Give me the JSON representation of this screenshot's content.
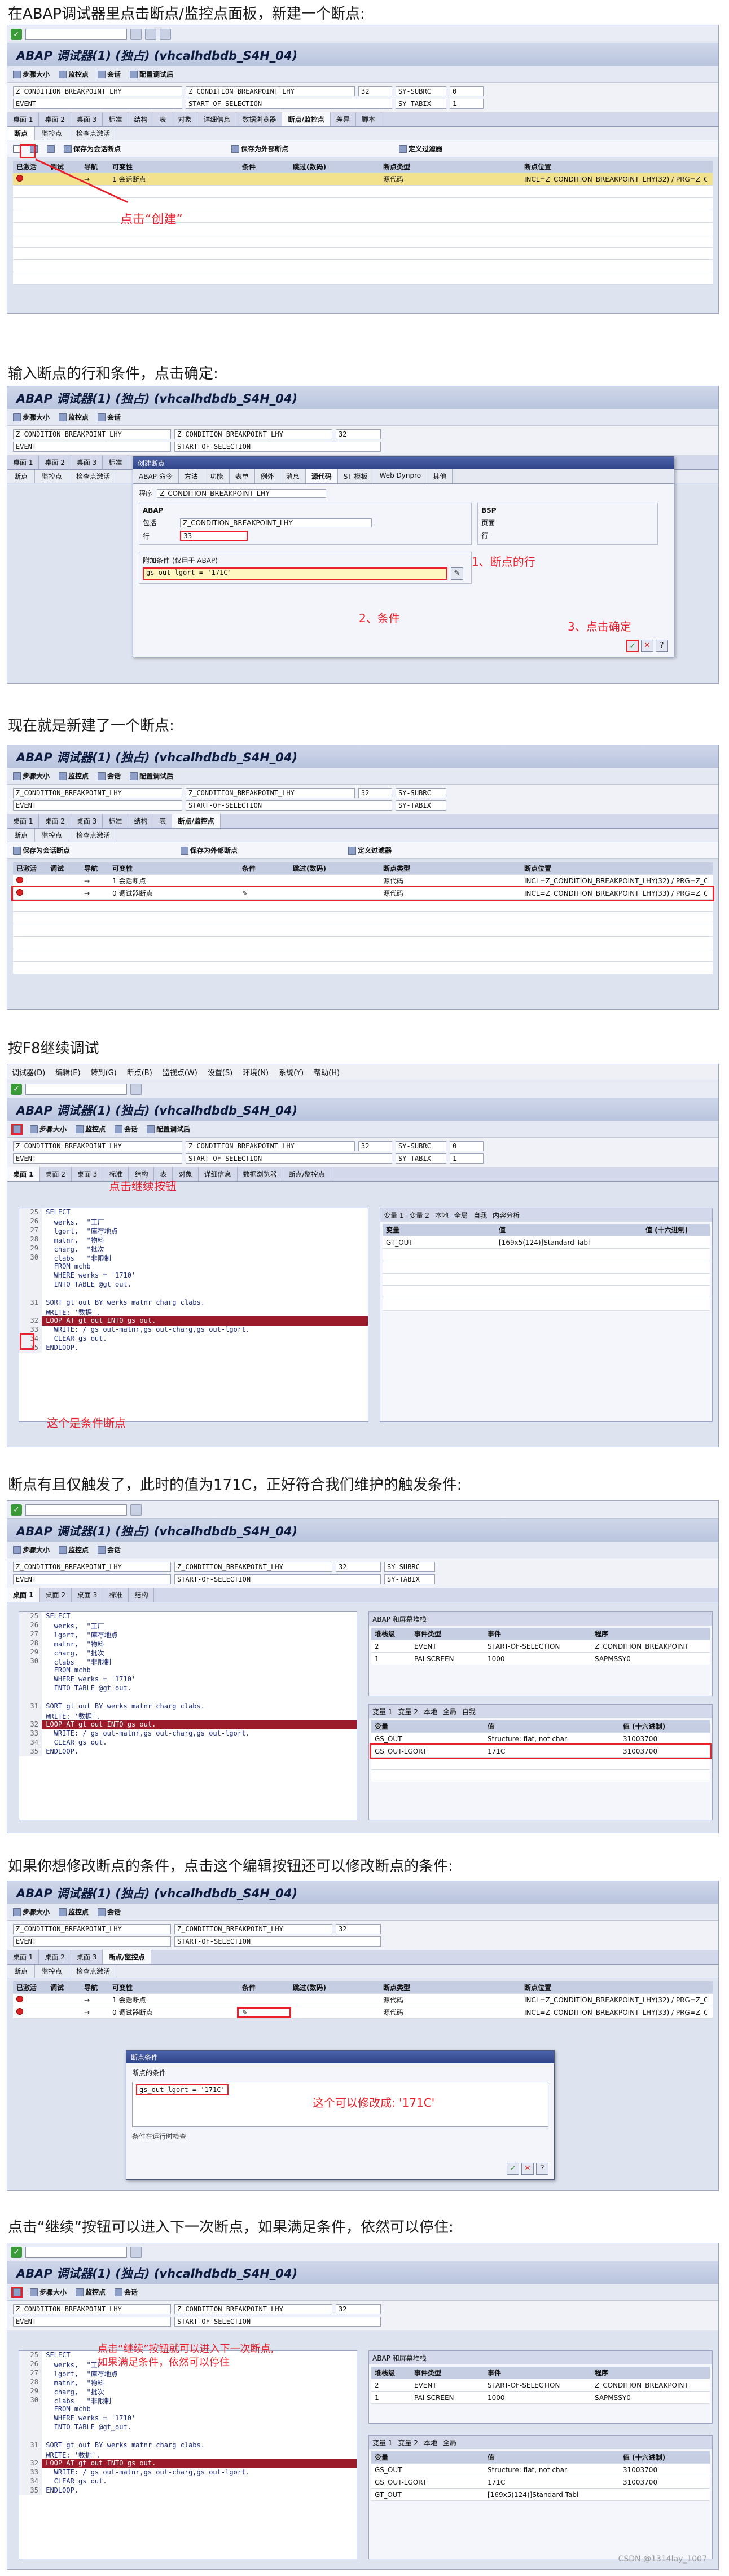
{
  "steps": [
    "在ABAP调试器里点击断点/监控点面板，新建一个断点:",
    "输入断点的行和条件，点击确定:",
    "现在就是新建了一个断点:",
    "按F8继续调试",
    "断点有且仅触发了，此时的值为171C，正好符合我们维护的触发条件:",
    "如果你想修改断点的条件，点击这个编辑按钮还可以修改断点的条件:",
    "点击“继续”按钮可以进入下一次断点，如果满足条件，依然可以停住:"
  ],
  "app_title": "ABAP 调试器(1) (独占) (vhcalhdbdb_S4H_04)",
  "menu": [
    "调试器(D)",
    "编辑(E)",
    "转到(G)",
    "断点(B)",
    "监视点(W)",
    "设置(S)",
    "环境(N)",
    "系统(Y)",
    "帮助(H)"
  ],
  "toolbar2": [
    "步骤大小",
    "监控点",
    "会话",
    "配置调试后"
  ],
  "fields": {
    "prog1": "Z_CONDITION_BREAKPOINT_LHY",
    "prog2": "Z_CONDITION_BREAKPOINT_LHY",
    "line": "32",
    "sy_subrc_label": "SY-SUBRC",
    "sy_subrc": "0",
    "event_label": "EVENT",
    "event": "START-OF-SELECTION",
    "sy_tabix_label": "SY-TABIX",
    "sy_tabix": "1"
  },
  "tabs": [
    "桌面 1",
    "桌面 2",
    "桌面 3",
    "标准",
    "结构",
    "表",
    "对象",
    "详细信息",
    "数据浏览器",
    "断点/监控点",
    "差异",
    "脚本"
  ],
  "subtabs": [
    "断点",
    "监控点",
    "检查点激活"
  ],
  "bp_toolbar": [
    "保存为会话断点",
    "保存为外部断点",
    "定义过滤器"
  ],
  "bp_table": {
    "headers": [
      "已激活",
      "调试",
      "导航",
      "可变性",
      "条件",
      "跳过(数码)",
      "断点类型",
      "断点位置"
    ],
    "rows1": [
      {
        "num": "1",
        "type": "会话断点",
        "loc_type": "源代码",
        "loc": "INCL=Z_CONDITION_BREAKPOINT_LHY(32) / PRG=Z_C"
      }
    ],
    "rows2": [
      {
        "num": "1",
        "type": "会话断点",
        "loc_type": "源代码",
        "loc": "INCL=Z_CONDITION_BREAKPOINT_LHY(32) / PRG=Z_C"
      },
      {
        "num": "0",
        "type": "调试器断点",
        "loc_type": "源代码",
        "loc": "INCL=Z_CONDITION_BREAKPOINT_LHY(33) / PRG=Z_C"
      }
    ]
  },
  "annotations": {
    "create": "点击“创建”",
    "line": "1、断点的行",
    "cond": "2、条件",
    "ok": "3、点击确定",
    "next": "点击继续按钮",
    "cond_bp": "这个是条件断点",
    "modify": "这个可以修改成: '171C'",
    "continue": "点击“继续”按钮就可以进入下一次断点,\n如果满足条件，依然可以停住"
  },
  "dialog1": {
    "title": "创建断点",
    "tabs": [
      "ABAP 命令",
      "方法",
      "功能",
      "表单",
      "例外",
      "消息",
      "源代码",
      "ST 模板",
      "Web Dynpro",
      "其他"
    ],
    "prog_label": "程序",
    "prog": "Z_CONDITION_BREAKPOINT_LHY",
    "incl_label": "包括",
    "incl": "Z_CONDITION_BREAKPOINT_LHY",
    "line_label": "行",
    "line": "33",
    "cond_label": "附加条件 (仅用于 ABAP)",
    "cond": "gs_out-lgort = '171C'",
    "sec_abap": "ABAP",
    "sec_bsp": "BSP",
    "page_label": "页面",
    "bsp_line": "行"
  },
  "dialog2": {
    "title": "断点条件",
    "label": "断点的条件",
    "cond": "gs_out-lgort = '171C'",
    "status": "条件在运行时检查"
  },
  "code": [
    {
      "n": "25",
      "t": "SELECT"
    },
    {
      "n": "26",
      "t": "  werks,  \"工厂"
    },
    {
      "n": "27",
      "t": "  lgort,  \"库存地点"
    },
    {
      "n": "28",
      "t": "  matnr,  \"物料"
    },
    {
      "n": "29",
      "t": "  charg,  \"批次"
    },
    {
      "n": "30",
      "t": "  clabs   \"非限制"
    },
    {
      "n": "",
      "t": "  FROM mchb"
    },
    {
      "n": "",
      "t": "  WHERE werks = '1710'"
    },
    {
      "n": "",
      "t": "  INTO TABLE @gt_out."
    },
    {
      "n": "",
      "t": ""
    },
    {
      "n": "31",
      "t": "SORT gt_out BY werks matnr charg clabs."
    },
    {
      "n": "",
      "t": "WRITE: '数据'."
    },
    {
      "n": "32",
      "t": "LOOP AT gt_out INTO gs_out."
    },
    {
      "n": "33",
      "t": "  WRITE: / gs_out-matnr,gs_out-charg,gs_out-lgort."
    },
    {
      "n": "34",
      "t": "  CLEAR gs_out."
    },
    {
      "n": "35",
      "t": "ENDLOOP."
    }
  ],
  "var_panel": {
    "tabs": [
      "变量 1",
      "变量 2",
      "本地",
      "全局",
      "自我",
      "内容分析"
    ],
    "headers": [
      "变量",
      "值",
      "值 (十六进制)"
    ],
    "rows1": [
      {
        "var": "GT_OUT",
        "val": "[169x5(124)]Standard Tabl"
      }
    ],
    "rows2": [
      {
        "var": "GS_OUT",
        "val": "Structure: flat, not char",
        "hex": "31003700"
      },
      {
        "var": "GS_OUT-LGORT",
        "val": "171C",
        "hex": "31003700"
      }
    ],
    "rows3": [
      {
        "var": "GS_OUT",
        "val": "Structure: flat, not char",
        "hex": "31003700"
      },
      {
        "var": "GS_OUT-LGORT",
        "val": "171C",
        "hex": "31003700"
      },
      {
        "var": "GT_OUT",
        "val": "[169x5(124)]Standard Tabl",
        "hex": ""
      }
    ]
  },
  "stack_panel": {
    "title": "ABAP 和屏幕堆栈",
    "headers": [
      "堆栈级",
      "事件类型",
      "事件",
      "程序"
    ],
    "rows": [
      {
        "lvl": "2",
        "type": "EVENT",
        "ev": "START-OF-SELECTION",
        "prog": "Z_CONDITION_BREAKPOINT"
      },
      {
        "lvl": "1",
        "type": "PAI SCREEN",
        "ev": "1000",
        "prog": "SAPMSSY0"
      }
    ]
  },
  "watermark": "CSDN @1314lay_1007",
  "colors": {
    "annotation": "#e8212c",
    "title_bar": "#b9c4de"
  }
}
